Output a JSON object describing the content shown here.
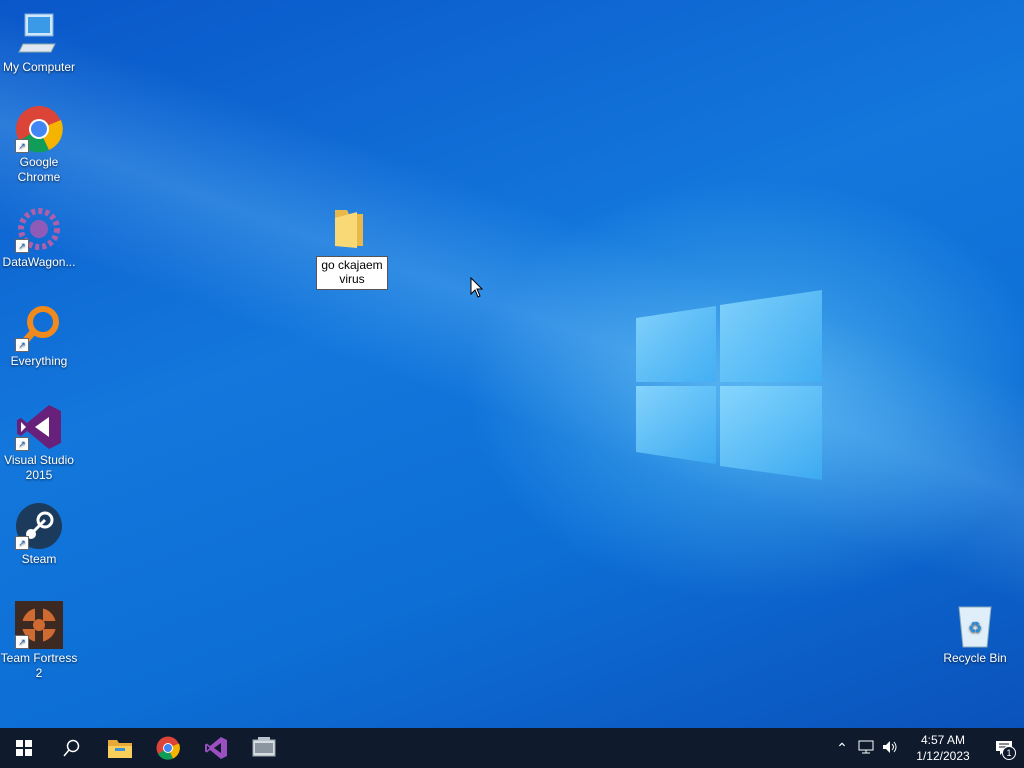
{
  "desktop": {
    "icons": [
      {
        "label": "My Computer"
      },
      {
        "label": "Google Chrome"
      },
      {
        "label": "DataWagon..."
      },
      {
        "label": "Everything"
      },
      {
        "label": "Visual Studio 2015"
      },
      {
        "label": "Steam"
      },
      {
        "label": "Team Fortress 2"
      },
      {
        "label": "Recycle Bin"
      }
    ],
    "rename_folder": {
      "value": "go ckajaem virus"
    }
  },
  "taskbar": {
    "time": "4:57 AM",
    "date": "1/12/2023",
    "notification_count": "1",
    "pinned": [
      "windows-start",
      "search",
      "file-explorer",
      "chrome",
      "visual-studio",
      "app"
    ]
  },
  "colors": {
    "taskbar": "#0f1b2d",
    "desktop_blue": "#1377dc"
  }
}
